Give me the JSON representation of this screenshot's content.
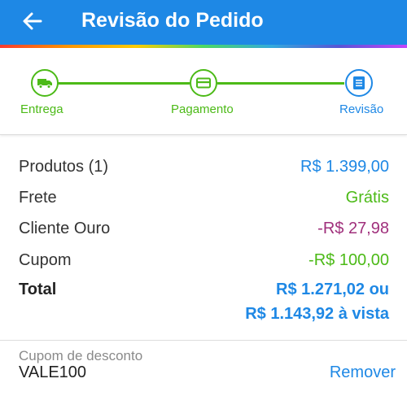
{
  "header": {
    "title": "Revisão do Pedido",
    "back_icon": "arrow-left-icon",
    "background": "#1e88e5"
  },
  "steps": [
    {
      "label": "Entrega",
      "icon": "truck-icon",
      "state": "done"
    },
    {
      "label": "Pagamento",
      "icon": "credit-card-icon",
      "state": "done"
    },
    {
      "label": "Revisão",
      "icon": "document-icon",
      "state": "active"
    }
  ],
  "summary": {
    "rows": [
      {
        "label": "Produtos (1)",
        "value": "R$ 1.399,00",
        "color": "#1e88e5"
      },
      {
        "label": "Frete",
        "value": "Grátis",
        "color": "#4cba17"
      },
      {
        "label": "Cliente Ouro",
        "value": "-R$ 27,98",
        "color": "#a0307c"
      },
      {
        "label": "Cupom",
        "value": "-R$ 100,00",
        "color": "#4cba17"
      }
    ],
    "total": {
      "label": "Total",
      "value_line1": "R$ 1.271,02 ou",
      "value_line2": "R$ 1.143,92 à vista"
    }
  },
  "coupon": {
    "label": "Cupom de desconto",
    "value": "VALE100",
    "remove_label": "Remover"
  },
  "colors": {
    "primary": "#1e88e5",
    "success": "#4cba17",
    "gold_discount": "#a0307c"
  }
}
